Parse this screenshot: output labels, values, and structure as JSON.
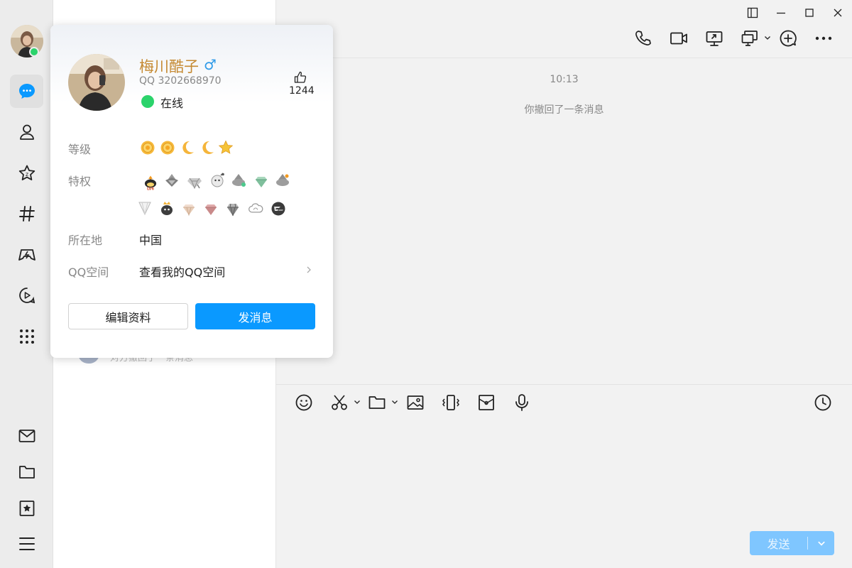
{
  "nav": {
    "items": [
      {
        "name": "messages",
        "icon": "chat-bubble-icon",
        "active": true
      },
      {
        "name": "contacts",
        "icon": "person-icon"
      },
      {
        "name": "favorites",
        "icon": "star-icon"
      },
      {
        "name": "channels",
        "icon": "hash-icon"
      },
      {
        "name": "games",
        "icon": "gamepad-icon"
      },
      {
        "name": "video",
        "icon": "video-play-icon"
      },
      {
        "name": "apps",
        "icon": "grid-icon"
      }
    ],
    "bottom": [
      {
        "name": "mail",
        "icon": "mail-icon"
      },
      {
        "name": "files",
        "icon": "folder-icon"
      },
      {
        "name": "bookmarks",
        "icon": "bookmark-star-icon"
      },
      {
        "name": "menu",
        "icon": "hamburger-icon"
      }
    ],
    "online_color": "#2bd36b"
  },
  "list": {
    "preview_text": "对方撤回了一条消息"
  },
  "chat": {
    "time": "10:13",
    "system_message": "你撤回了一条消息",
    "send_label": "发送",
    "accent": "#0a99ff"
  },
  "card": {
    "nickname": "梅川酷子",
    "gender_symbol": "♂",
    "qq_line": "QQ 3202668970",
    "status": "在线",
    "likes": "1244",
    "level_label": "等级",
    "privilege_label": "特权",
    "location_label": "所在地",
    "location_value": "中国",
    "qzone_label": "QQ空间",
    "qzone_value": "查看我的QQ空间",
    "edit_label": "编辑资料",
    "message_label": "发消息"
  }
}
